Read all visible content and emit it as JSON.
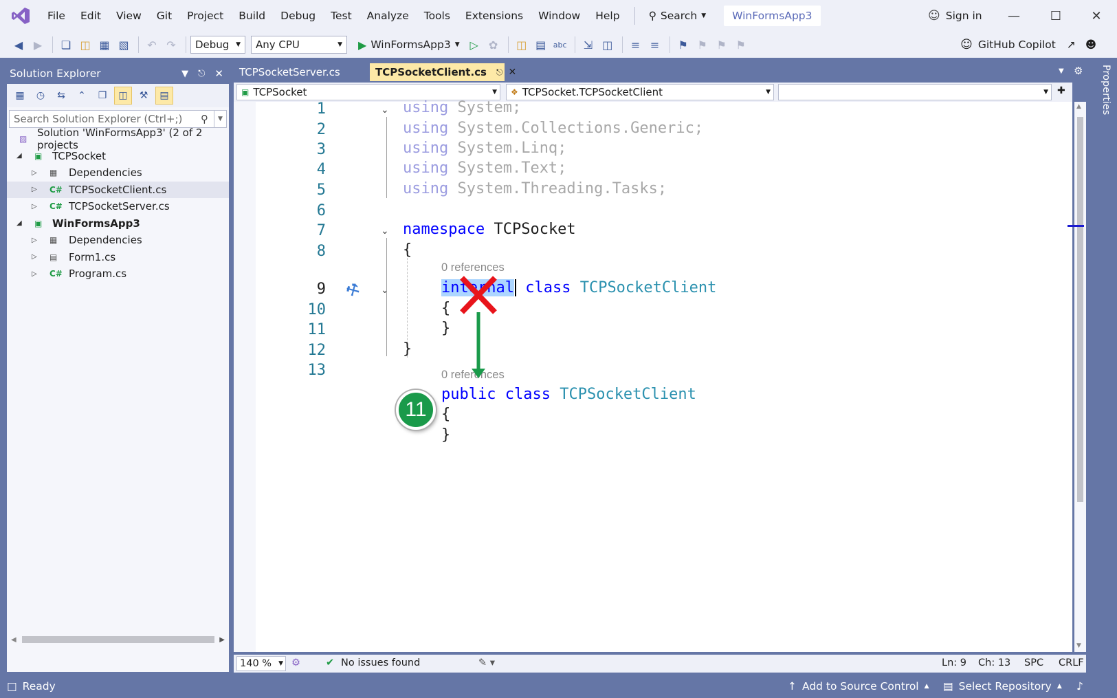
{
  "menu": {
    "items": [
      "File",
      "Edit",
      "View",
      "Git",
      "Project",
      "Build",
      "Debug",
      "Test",
      "Analyze",
      "Tools",
      "Extensions",
      "Window",
      "Help"
    ],
    "search_label": "Search",
    "solution_name": "WinFormsApp3",
    "sign_in": "Sign in"
  },
  "toolbar": {
    "config": "Debug",
    "platform": "Any CPU",
    "run_target": "WinFormsApp3",
    "copilot": "GitHub Copilot"
  },
  "solution_explorer": {
    "title": "Solution Explorer",
    "search_placeholder": "Search Solution Explorer (Ctrl+;)",
    "tree": [
      {
        "label": "Solution 'WinFormsApp3' (2 of 2 projects",
        "icon": "solution-icon"
      },
      {
        "label": "TCPSocket",
        "icon": "csharp-project-icon"
      },
      {
        "label": "Dependencies",
        "icon": "dependencies-icon"
      },
      {
        "label": "TCPSocketClient.cs",
        "icon": "csharp-file-icon"
      },
      {
        "label": "TCPSocketServer.cs",
        "icon": "csharp-file-icon"
      },
      {
        "label": "WinFormsApp3",
        "icon": "csharp-project-icon"
      },
      {
        "label": "Dependencies",
        "icon": "dependencies-icon"
      },
      {
        "label": "Form1.cs",
        "icon": "form-file-icon"
      },
      {
        "label": "Program.cs",
        "icon": "csharp-file-icon"
      }
    ]
  },
  "editor": {
    "tabs": [
      {
        "label": "TCPSocketServer.cs",
        "active": false
      },
      {
        "label": "TCPSocketClient.cs",
        "active": true
      }
    ],
    "nav": {
      "project": "TCPSocket",
      "type": "TCPSocket.TCPSocketClient",
      "member": ""
    },
    "line_numbers": [
      "1",
      "2",
      "3",
      "4",
      "5",
      "6",
      "7",
      "8",
      "9",
      "10",
      "11",
      "12",
      "13"
    ],
    "code": {
      "using_kw": "using",
      "usings": [
        "System;",
        "System.Collections.Generic;",
        "System.Linq;",
        "System.Text;",
        "System.Threading.Tasks;"
      ],
      "namespace_kw": "namespace",
      "namespace_name": "TCPSocket",
      "open_brace": "{",
      "close_brace": "}",
      "references": "0 references",
      "internal_kw": "internal",
      "class_kw": "class",
      "class_name": "TCPSocketClient",
      "public_kw": "public"
    },
    "zoom": "140 %",
    "issues": "No issues found",
    "position": {
      "line": "Ln: 9",
      "col": "Ch: 13",
      "indent": "SPC",
      "eol": "CRLF"
    }
  },
  "annotation": {
    "step": "11",
    "colors": {
      "cross": "#e8141b",
      "arrow": "#1a9a4a"
    }
  },
  "side_panel": {
    "properties": "Properties"
  },
  "status": {
    "ready": "Ready",
    "source_control": "Add to Source Control",
    "repository": "Select Repository"
  },
  "colors": {
    "frame": "#6576a6",
    "tab_active": "#fde9a7",
    "keyword": "#0000ff",
    "type": "#2b91af"
  }
}
